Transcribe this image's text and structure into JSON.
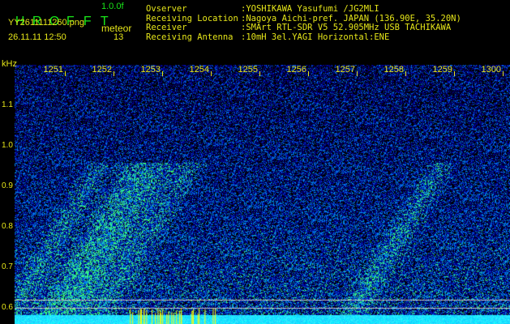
{
  "app": {
    "title_letters": [
      "H",
      "R",
      "O",
      "F",
      "F",
      "T"
    ],
    "version": "1.0.0f"
  },
  "file": {
    "name": "YY2611111260.png",
    "datetime": "26.11.11 12:50"
  },
  "meteor": {
    "label": "meteor",
    "count": "13"
  },
  "info": [
    {
      "label": "Ovserver",
      "value": ":YOSHIKAWA Yasufumi /JG2MLI"
    },
    {
      "label": "Receiving Location",
      "value": ":Nagoya Aichi-pref. JAPAN (136.90E, 35.20N)"
    },
    {
      "label": "Receiver",
      "value": ":SMArt RTL-SDR V5 52.905MHz USB TACHIKAWA"
    },
    {
      "label": "Receiving Antenna",
      "value": ":10mH 3el.YAGI Horizontal:ENE"
    }
  ],
  "spectrogram": {
    "unit": "kHz",
    "time_ticks": [
      "1251",
      "1252",
      "1253",
      "1254",
      "1255",
      "1256",
      "1257",
      "1258",
      "1259",
      "1300"
    ],
    "freq_ticks": [
      "1.1",
      "1.0",
      "0.9",
      "0.8",
      "0.7",
      "0.6"
    ],
    "colors": {
      "background": "#000000",
      "low": "#0000a0",
      "mid": "#2060ff",
      "high": "#40ff80",
      "text": "#e6e619",
      "title": "#19e619"
    }
  }
}
